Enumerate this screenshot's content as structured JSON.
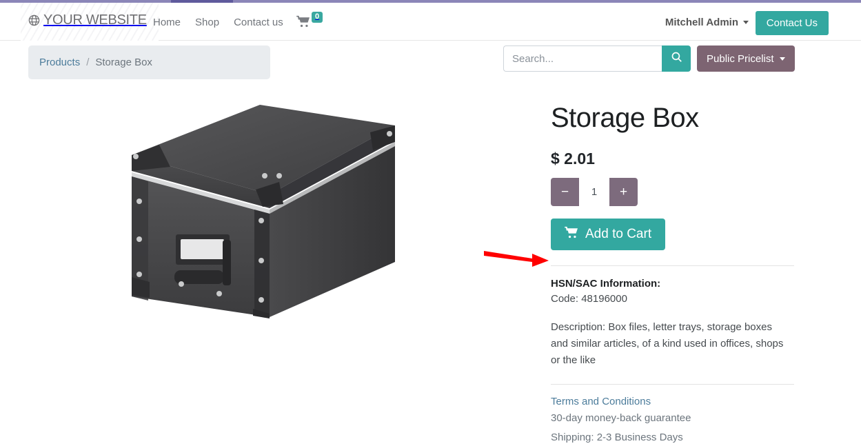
{
  "header": {
    "brand_name": "YOUR WEBSITE",
    "brand_icon": "globe-icon",
    "nav": [
      {
        "label": "Home"
      },
      {
        "label": "Shop"
      },
      {
        "label": "Contact us"
      }
    ],
    "cart": {
      "icon": "shopping-cart-icon",
      "count": "0"
    },
    "user_menu": {
      "label": "Mitchell Admin",
      "icon": "chevron-down-icon"
    },
    "contact_button": {
      "label": "Contact Us"
    },
    "accent_color": "#33a8a0",
    "top_strip_color": "#8b86b8"
  },
  "breadcrumb": {
    "parent": "Products",
    "separator": "/",
    "current": "Storage Box"
  },
  "search": {
    "placeholder": "Search...",
    "value": "",
    "button_icon": "search-icon"
  },
  "pricelist": {
    "label": "Public Pricelist",
    "icon": "chevron-down-icon",
    "color": "#7d6472"
  },
  "product": {
    "title": "Storage Box",
    "price": "$ 2.01",
    "quantity": "1",
    "decrement_label": "−",
    "increment_label": "+",
    "add_to_cart_label": "Add to Cart",
    "add_to_cart_icon": "shopping-cart-icon",
    "image_alt": "Storage Box product photo"
  },
  "hsn": {
    "title": "HSN/SAC Information:",
    "code": "Code: 48196000",
    "description": "Description: Box files, letter trays, storage boxes and similar articles, of a kind used in offices, shops or the like"
  },
  "terms": {
    "link_label": "Terms and Conditions",
    "line1": "30-day money-back guarantee",
    "line2": "Shipping: 2-3 Business Days"
  },
  "annotation": {
    "arrow_color": "#ff0000",
    "points_to": "HSN/SAC Information:"
  }
}
